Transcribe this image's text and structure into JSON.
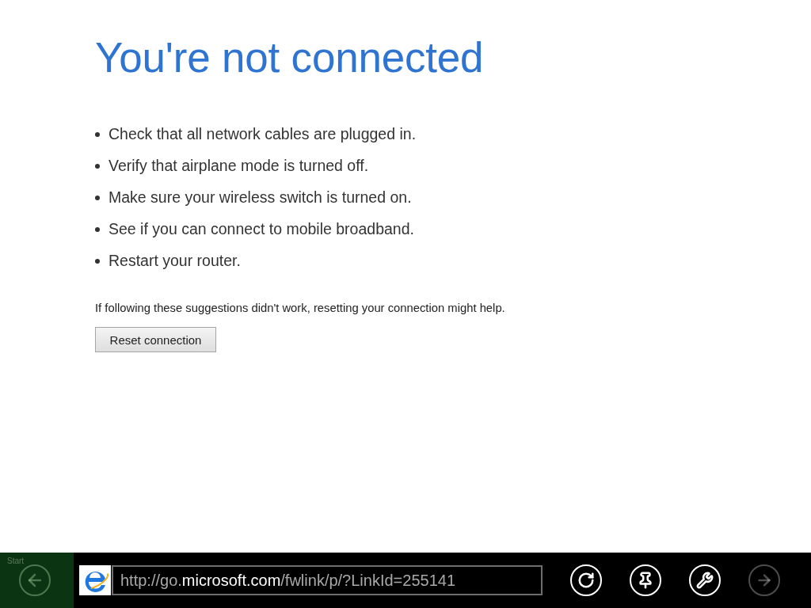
{
  "page": {
    "title": "You're not connected",
    "suggestions": [
      "Check that all network cables are plugged in.",
      "Verify that airplane mode is turned off.",
      "Make sure your wireless switch is turned on.",
      "See if you can connect to mobile broadband.",
      "Restart your router."
    ],
    "help_text": "If following these suggestions didn't work, resetting your connection might help.",
    "reset_button": {
      "label": "Reset connection"
    }
  },
  "app_bar": {
    "start_tile": {
      "label": "Start"
    },
    "back_button": {
      "disabled": true
    },
    "address": {
      "prefix": "http://go.",
      "domain": "microsoft.com",
      "path": "/fwlink/p/?LinkId=255141"
    },
    "buttons": [
      {
        "kind": "refresh",
        "disabled": false
      },
      {
        "kind": "pin",
        "disabled": false
      },
      {
        "kind": "settings",
        "disabled": false
      },
      {
        "kind": "forward",
        "disabled": true
      }
    ]
  }
}
